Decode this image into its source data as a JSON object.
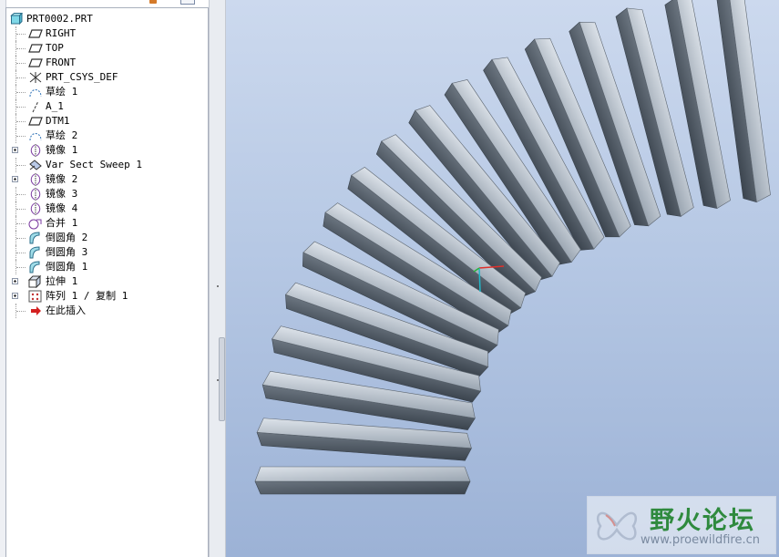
{
  "model_tree": {
    "root": {
      "label": "PRT0002.PRT",
      "icon": "part-icon"
    },
    "items": [
      {
        "label": "RIGHT",
        "icon": "datum-plane-icon",
        "expandable": false
      },
      {
        "label": "TOP",
        "icon": "datum-plane-icon",
        "expandable": false
      },
      {
        "label": "FRONT",
        "icon": "datum-plane-icon",
        "expandable": false
      },
      {
        "label": "PRT_CSYS_DEF",
        "icon": "coordinate-system-icon",
        "expandable": false
      },
      {
        "label": "草绘 1",
        "icon": "sketch-icon",
        "expandable": false
      },
      {
        "label": "A_1",
        "icon": "datum-axis-icon",
        "expandable": false
      },
      {
        "label": "DTM1",
        "icon": "datum-plane-icon",
        "expandable": false
      },
      {
        "label": "草绘 2",
        "icon": "sketch-icon",
        "expandable": false
      },
      {
        "label": "镜像 1",
        "icon": "mirror-icon",
        "expandable": true
      },
      {
        "label": "Var Sect Sweep 1",
        "icon": "sweep-icon",
        "expandable": false
      },
      {
        "label": "镜像 2",
        "icon": "mirror-icon",
        "expandable": true
      },
      {
        "label": "镜像 3",
        "icon": "mirror-icon",
        "expandable": false
      },
      {
        "label": "镜像 4",
        "icon": "mirror-icon",
        "expandable": false
      },
      {
        "label": "合并 1",
        "icon": "merge-icon",
        "expandable": false
      },
      {
        "label": "倒圆角 2",
        "icon": "round-icon",
        "expandable": false
      },
      {
        "label": "倒圆角 3",
        "icon": "round-icon",
        "expandable": false
      },
      {
        "label": "倒圆角 1",
        "icon": "round-icon",
        "expandable": false
      },
      {
        "label": "拉伸 1",
        "icon": "extrude-icon",
        "expandable": true
      },
      {
        "label": "阵列 1 / 复制 1",
        "icon": "pattern-icon",
        "expandable": true
      },
      {
        "label": "在此插入",
        "icon": "insert-here-arrow-icon",
        "expandable": false
      }
    ]
  },
  "watermark": {
    "title": "野火论坛",
    "url": "www.proewildfire.cn"
  },
  "colors": {
    "viewport_top": "#ccd9ee",
    "viewport_bottom": "#9cb2d6",
    "model_light": "#c8d0d8",
    "model_dark": "#4b5560",
    "watermark_green": "#2f8a3e"
  }
}
